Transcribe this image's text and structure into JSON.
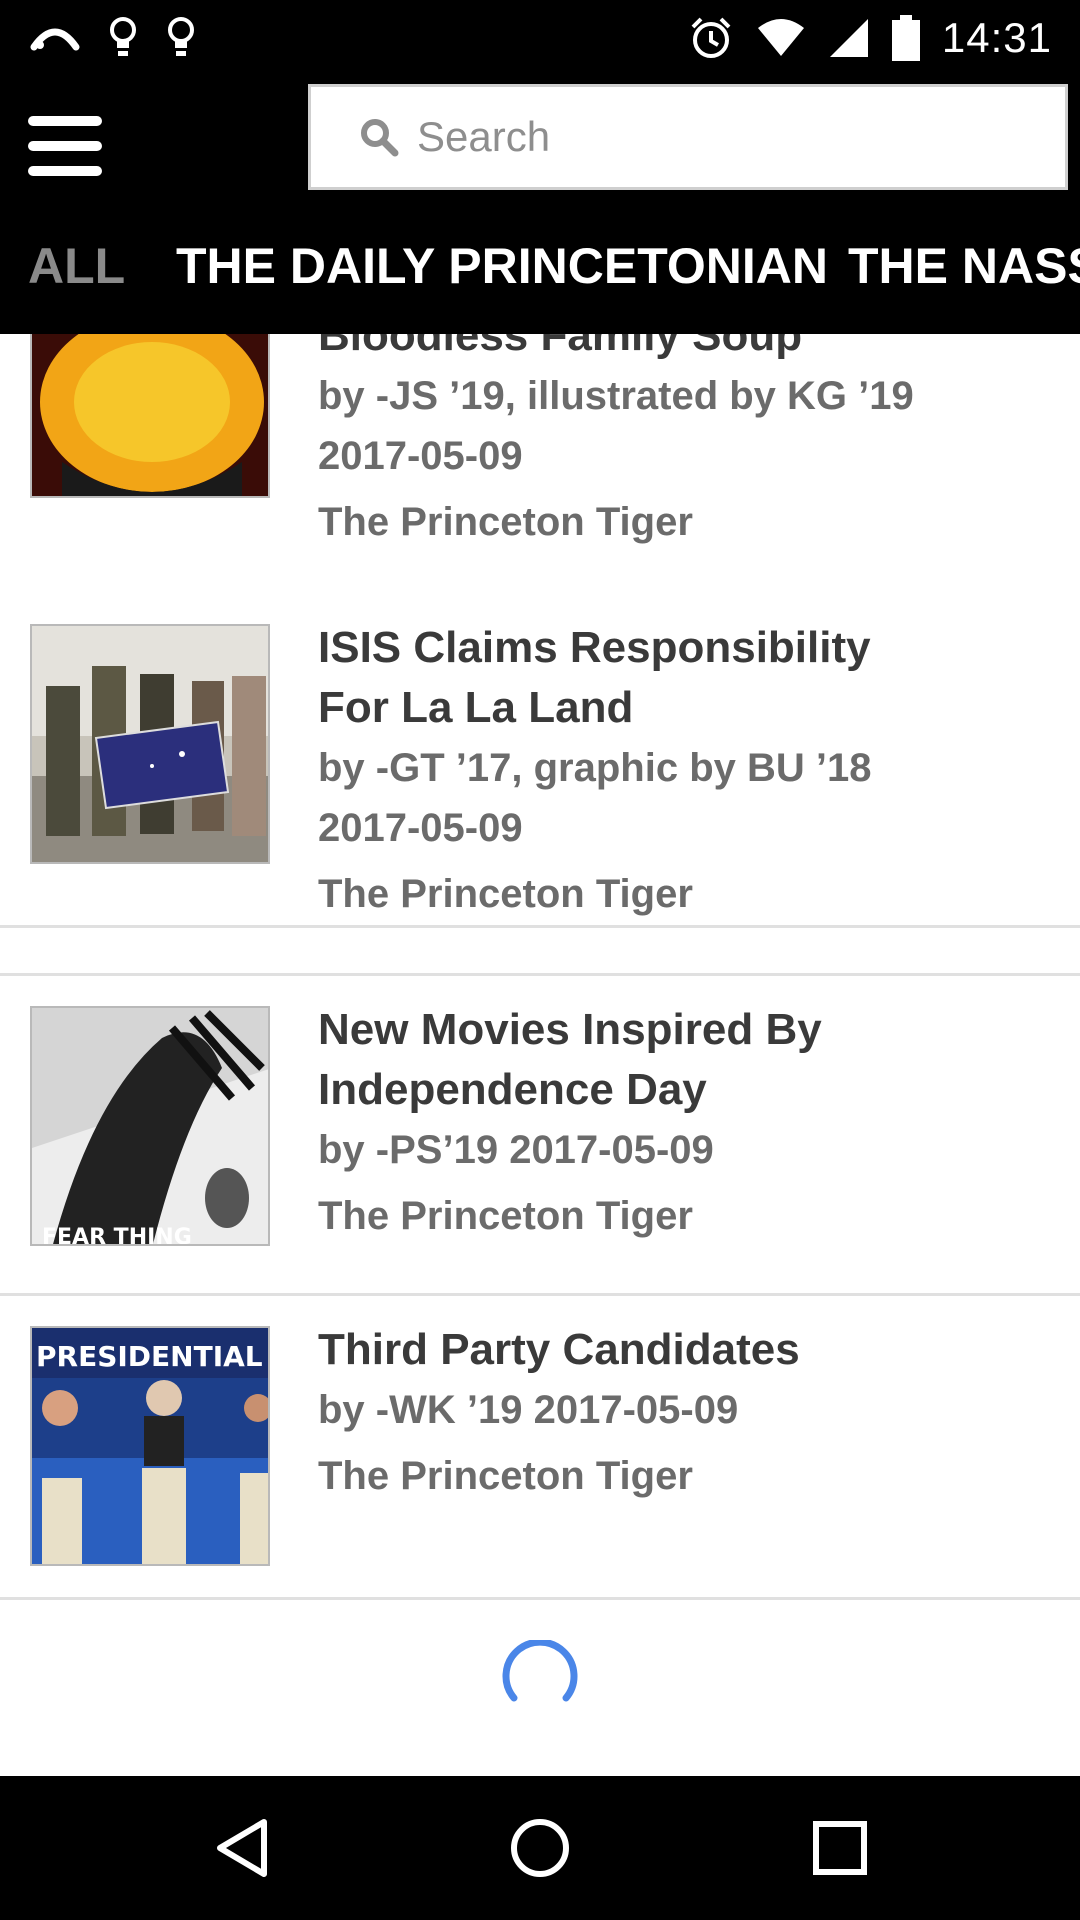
{
  "status_bar": {
    "time": "14:31",
    "icons": [
      "cast-icon",
      "lightbulb-icon",
      "lightbulb-icon",
      "alarm-icon",
      "wifi-icon",
      "signal-icon",
      "battery-icon"
    ]
  },
  "toolbar": {
    "menu_icon": "hamburger-menu-icon",
    "search": {
      "placeholder": "Search",
      "icon": "search-icon"
    }
  },
  "tabs": [
    {
      "label": "ALL",
      "active": false
    },
    {
      "label": "THE DAILY PRINCETONIAN",
      "active": true
    },
    {
      "label": "THE NASSAU WEEKLY",
      "active": false
    }
  ],
  "articles": [
    {
      "title": "Bloodless Family Soup",
      "byline": "by -JS ’19, illustrated by KG ’19",
      "date": "2017-05-09",
      "source": "The Princeton Tiger"
    },
    {
      "title_line1": "ISIS Claims Responsibility",
      "title_line2": "For La La Land",
      "byline": "by -GT ’17, graphic by BU ’18",
      "date": "2017-05-09",
      "source": "The Princeton Tiger"
    },
    {
      "title_line1": "New Movies Inspired By",
      "title_line2": "Independence Day",
      "byline_date": "by -PS’19 2017-05-09",
      "source": "The Princeton Tiger"
    },
    {
      "title": "Third Party Candidates",
      "byline_date": "by -WK ’19 2017-05-09",
      "source": "The Princeton Tiger",
      "thumb_text": "PRESIDENTIAL DEBATE"
    }
  ],
  "thumb_text": {
    "fear": "FEAR THING"
  },
  "colors": {
    "bar_background": "#000000",
    "tab_inactive": "#8a8a8a",
    "title_text": "#3a3a3a",
    "meta_text": "#6b6b6b",
    "spinner": "#4a86e8"
  },
  "nav_bar": {
    "icons": [
      "back-icon",
      "home-icon",
      "recents-icon"
    ]
  }
}
